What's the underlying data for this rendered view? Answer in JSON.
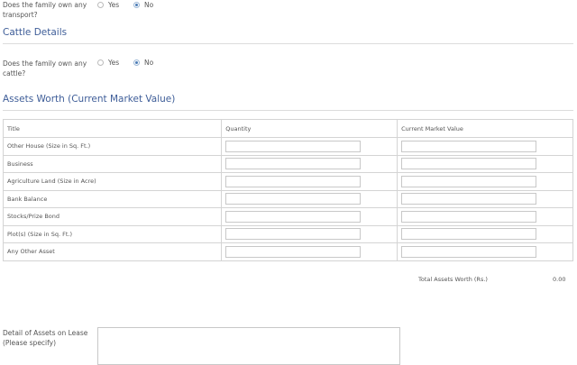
{
  "transport": {
    "question": "Does the family own any transport?",
    "options": [
      {
        "label": "Yes",
        "checked": false
      },
      {
        "label": "No",
        "checked": true
      }
    ]
  },
  "cattle": {
    "title": "Cattle Details",
    "question": "Does the family own any cattle?",
    "options": [
      {
        "label": "Yes",
        "checked": false
      },
      {
        "label": "No",
        "checked": true
      }
    ]
  },
  "assets": {
    "title": "Assets Worth (Current Market Value)",
    "columns": [
      "Title",
      "Quantity",
      "Current Market Value"
    ],
    "rows": [
      {
        "title": "Other House (Size in Sq. Ft.)",
        "quantity": "",
        "value": ""
      },
      {
        "title": "Business",
        "quantity": "",
        "value": ""
      },
      {
        "title": "Agriculture Land (Size in Acre)",
        "quantity": "",
        "value": ""
      },
      {
        "title": "Bank Balance",
        "quantity": "",
        "value": ""
      },
      {
        "title": "Stocks/Prize Bond",
        "quantity": "",
        "value": ""
      },
      {
        "title": "Plot(s) (Size in Sq. Ft.)",
        "quantity": "",
        "value": ""
      },
      {
        "title": "Any Other Asset",
        "quantity": "",
        "value": ""
      }
    ],
    "total_label": "Total Assets Worth (Rs.)",
    "total_value": "0.00"
  },
  "lease": {
    "label": "Detail of Assets on Lease (Please specify)",
    "value": ""
  },
  "colors": {
    "accent": "#3e5d98",
    "radio_checked": "#4a7bb5"
  }
}
